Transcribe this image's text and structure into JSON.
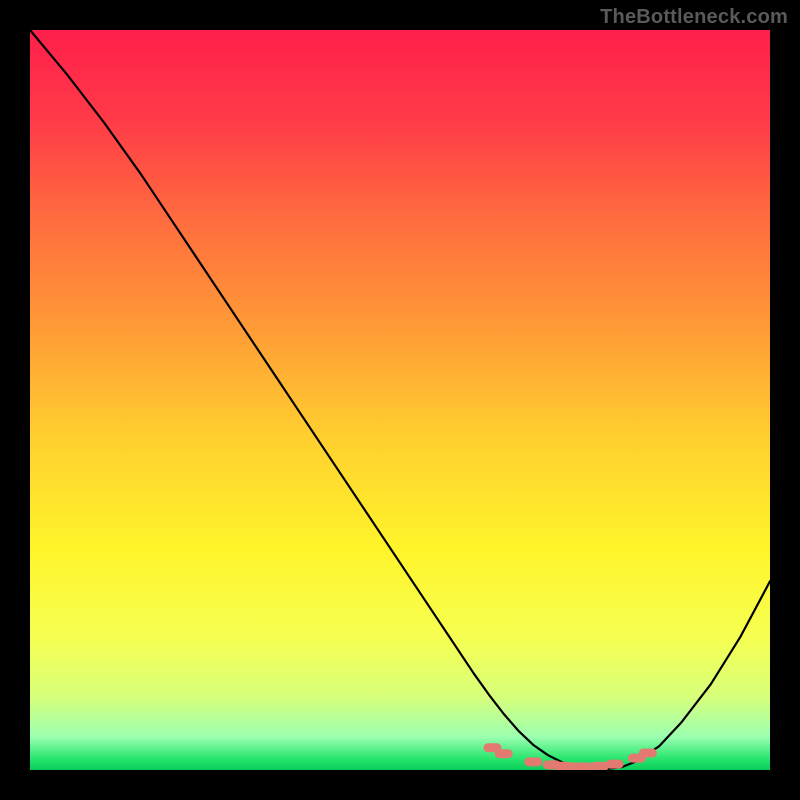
{
  "watermark": "TheBottleneck.com",
  "colors": {
    "bg": "#000000",
    "marker": "#e27a72",
    "curve": "#000000"
  },
  "chart_data": {
    "type": "line",
    "title": "",
    "xlabel": "",
    "ylabel": "",
    "xlim": [
      0,
      100
    ],
    "ylim": [
      0,
      100
    ],
    "grid": false,
    "annotations": [
      "TheBottleneck.com"
    ],
    "series": [
      {
        "name": "bottleneck-curve",
        "x": [
          0,
          5,
          10,
          15,
          20,
          25,
          30,
          35,
          40,
          45,
          50,
          55,
          60,
          62,
          64,
          66,
          68,
          70,
          72,
          74,
          76,
          78,
          80,
          82,
          85,
          88,
          92,
          96,
          100
        ],
        "y": [
          100,
          94,
          87.5,
          80.5,
          73,
          65.5,
          58,
          50.5,
          43,
          35.5,
          28,
          20.5,
          13,
          10.2,
          7.6,
          5.3,
          3.4,
          2.0,
          1.0,
          0.4,
          0.15,
          0.15,
          0.4,
          1.2,
          3.2,
          6.4,
          11.6,
          18.0,
          25.5
        ]
      },
      {
        "name": "optimal-markers",
        "x": [
          62.5,
          64,
          68,
          70.5,
          72,
          73.5,
          75,
          77,
          79,
          82,
          83.5
        ],
        "y": [
          3.0,
          2.2,
          1.1,
          0.7,
          0.5,
          0.4,
          0.4,
          0.5,
          0.8,
          1.6,
          2.3
        ]
      }
    ],
    "gradient_stops": [
      {
        "offset": 0.0,
        "color": "#ff1f4b"
      },
      {
        "offset": 0.12,
        "color": "#ff3a48"
      },
      {
        "offset": 0.25,
        "color": "#ff6a3f"
      },
      {
        "offset": 0.4,
        "color": "#ff9a36"
      },
      {
        "offset": 0.55,
        "color": "#ffcf2f"
      },
      {
        "offset": 0.7,
        "color": "#fff42a"
      },
      {
        "offset": 0.82,
        "color": "#f6ff51"
      },
      {
        "offset": 0.9,
        "color": "#d8ff7a"
      },
      {
        "offset": 0.955,
        "color": "#9cffb0"
      },
      {
        "offset": 0.985,
        "color": "#27e56d"
      },
      {
        "offset": 1.0,
        "color": "#0acc5a"
      }
    ]
  }
}
